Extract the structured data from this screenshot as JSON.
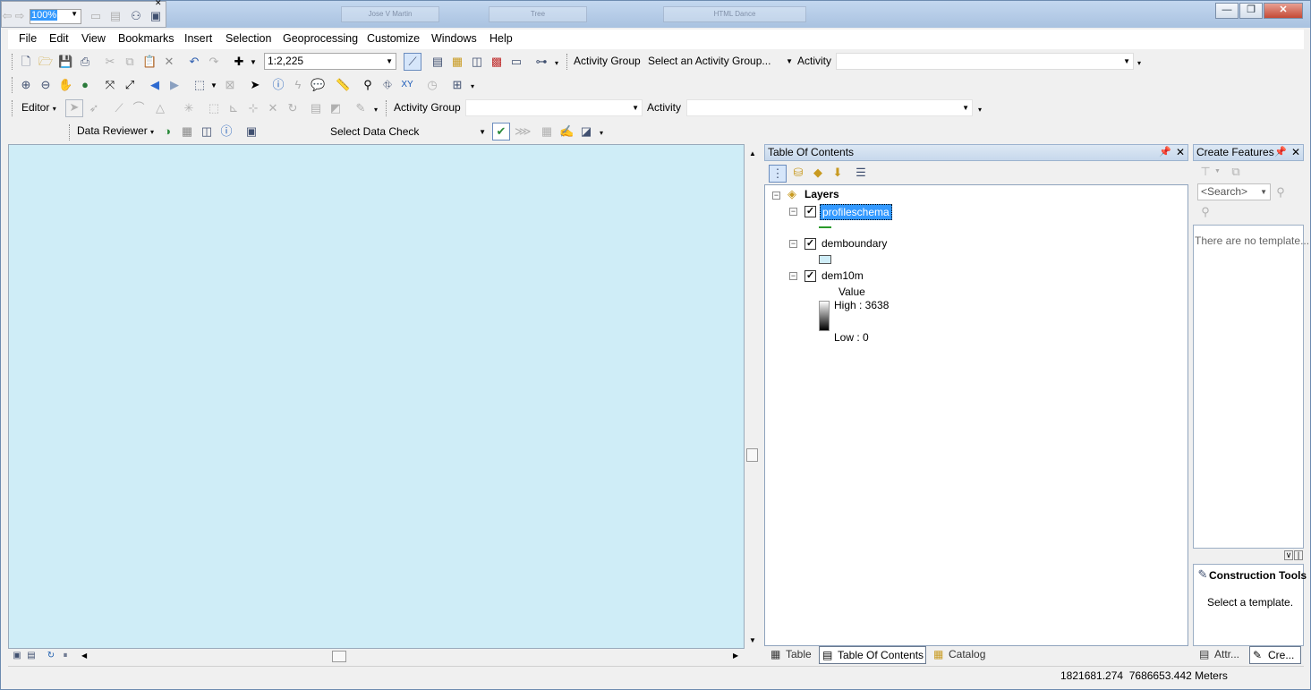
{
  "title_bar": {
    "ghost_labels": [
      "Jose V Martin",
      "Tree",
      "HTML Dance"
    ]
  },
  "mini_toolbar": {
    "zoom_value": "100%"
  },
  "menu": [
    "File",
    "Edit",
    "View",
    "Bookmarks",
    "Insert",
    "Selection",
    "Geoprocessing",
    "Customize",
    "Windows",
    "Help"
  ],
  "toolbar1": {
    "scale_value": "1:2,225",
    "activity_group_label": "Activity Group",
    "activity_group_select": "Select an Activity Group...",
    "activity_label": "Activity",
    "activity_value": ""
  },
  "toolbar3": {
    "editor_label": "Editor",
    "activity_group_label": "Activity Group",
    "activity_group_value": "",
    "activity_label": "Activity",
    "activity_value": ""
  },
  "toolbar4": {
    "data_reviewer_label": "Data Reviewer",
    "data_check_select": "Select Data Check"
  },
  "toc": {
    "title": "Table Of Contents",
    "root": "Layers",
    "layers": [
      {
        "name": "profileschema",
        "checked": "✓",
        "selected": true
      },
      {
        "name": "demboundary",
        "checked": "✓"
      },
      {
        "name": "dem10m",
        "checked": "✓",
        "legend_title": "Value",
        "high": "High : 3638",
        "low": "Low : 0"
      }
    ],
    "tabs": [
      "Table",
      "Table Of Contents",
      "Catalog"
    ]
  },
  "create_features": {
    "title": "Create Features",
    "search_placeholder": "<Search>",
    "empty_message": "There are no template...",
    "construction_title": "Construction Tools",
    "construction_message": "Select a template.",
    "tabs": [
      "Attr...",
      "Cre..."
    ]
  },
  "status": {
    "coordinates": "1821681.274  7686653.442 Meters"
  },
  "colors": {
    "map_background": "#cfedf7",
    "selection_highlight": "#3399ff"
  }
}
